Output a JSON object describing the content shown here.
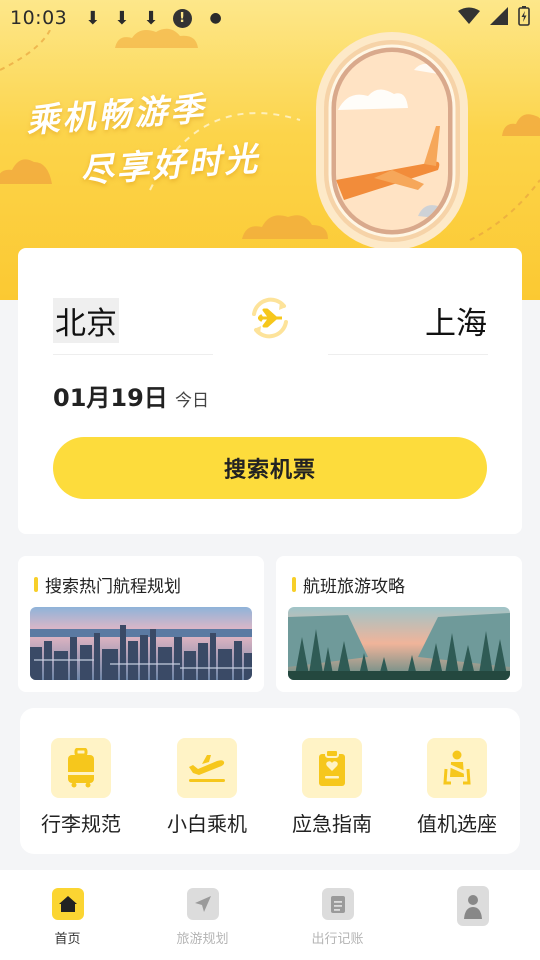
{
  "status_bar": {
    "time": "10:03",
    "icons": [
      "download-icon",
      "download-icon",
      "download-icon",
      "alert-icon",
      "dot-icon",
      "wifi-icon",
      "signal-icon",
      "battery-charging-icon"
    ]
  },
  "hero": {
    "slogan_line1": "乘机畅游季",
    "slogan_line2": "尽享好时光"
  },
  "search": {
    "from_city": "北京",
    "to_city": "上海",
    "swap_icon": "plane-swap-icon",
    "date": "01月19日",
    "day_label": "今日",
    "button_label": "搜索机票"
  },
  "promos": [
    {
      "title": "搜索热门航程规划",
      "image": "city-skyline"
    },
    {
      "title": "航班旅游攻略",
      "image": "forest-valley"
    }
  ],
  "services": [
    {
      "label": "行李规范",
      "icon": "luggage-icon"
    },
    {
      "label": "小白乘机",
      "icon": "plane-takeoff-icon"
    },
    {
      "label": "应急指南",
      "icon": "clipboard-heart-icon"
    },
    {
      "label": "值机选座",
      "icon": "seat-belt-icon"
    }
  ],
  "tabbar": {
    "tabs": [
      {
        "label": "首页",
        "icon": "home-icon",
        "active": true
      },
      {
        "label": "旅游规划",
        "icon": "paper-plane-icon",
        "active": false
      },
      {
        "label": "出行记账",
        "icon": "clipboard-icon",
        "active": false
      },
      {
        "label": "",
        "icon": "profile-icon",
        "active": false
      }
    ]
  },
  "colors": {
    "accent": "#fddc3c",
    "hero_top": "#fde78a",
    "hero_bottom": "#fbc932",
    "icon_bg": "#fff3c6",
    "tab_active": "#fbd532"
  }
}
